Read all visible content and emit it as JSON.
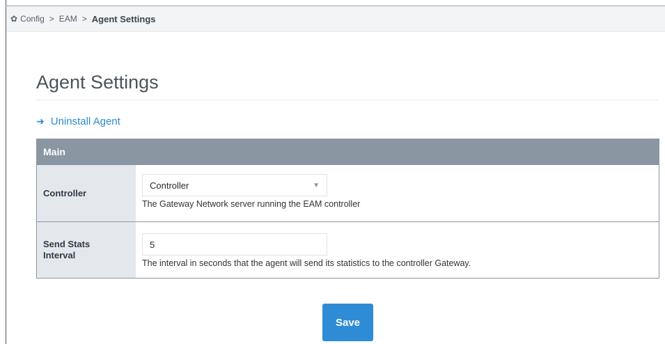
{
  "breadcrumb": {
    "icon": "gear-icon",
    "items": [
      "Config",
      "EAM"
    ],
    "separator": ">",
    "current": "Agent Settings"
  },
  "page": {
    "title": "Agent Settings"
  },
  "actions": {
    "uninstall_icon": "arrow-right-icon",
    "uninstall_label": "Uninstall Agent"
  },
  "section": {
    "header": "Main",
    "rows": [
      {
        "label": "Controller",
        "value": "Controller",
        "help": "The Gateway Network server running the EAM controller"
      },
      {
        "label": "Send Stats Interval",
        "value": "5",
        "help": "The interval in seconds that the agent will send its statistics to the controller Gateway."
      }
    ]
  },
  "footer": {
    "save_label": "Save"
  },
  "colors": {
    "accent": "#2e8bd6",
    "link": "#2e8bc9",
    "section_header": "#8a96a2",
    "label_bg": "#e4e8ec"
  }
}
